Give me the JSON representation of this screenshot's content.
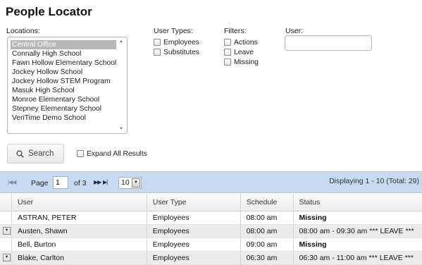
{
  "page": {
    "title": "People Locator"
  },
  "locations": {
    "label": "Locations:",
    "items": [
      "Central Office",
      "Connally High School",
      "Fawn Hollow Elementary School",
      "Jockey Hollow School",
      "Jockey Hollow STEM Program",
      "Masuk High School",
      "Monroe Elementary School",
      "Stepney Elementary School",
      "VeriTime Demo School"
    ],
    "selected_index": 0
  },
  "user_types": {
    "label": "User Types:",
    "options": [
      "Employees",
      "Substitutes"
    ]
  },
  "filters": {
    "label": "Filters:",
    "options": [
      "Actions",
      "Leave",
      "Missing"
    ]
  },
  "user": {
    "label": "User:",
    "value": ""
  },
  "search": {
    "label": "Search",
    "expand_label": "Expand All Results"
  },
  "pager": {
    "page_label": "Page",
    "page_value": "1",
    "of_label": "of 3",
    "page_size": "10",
    "displaying": "Displaying 1 - 10  (Total: 29)"
  },
  "table": {
    "columns": [
      "User",
      "User Type",
      "Schedule",
      "Status"
    ],
    "rows": [
      {
        "user": "ASTRAN, PETER",
        "type": "Employees",
        "schedule": "08:00 am",
        "status": "Missing"
      },
      {
        "user": "Austen, Shawn",
        "type": "Employees",
        "schedule": "08:00 am",
        "status": "08:00 am - 09:30 am *** LEAVE ***"
      },
      {
        "user": "Bell, Burton",
        "type": "Employees",
        "schedule": "09:00 am",
        "status": "Missing"
      },
      {
        "user": "Blake, Carlton",
        "type": "Employees",
        "schedule": "06:30 am",
        "status": "06:30 am - 11:00 am *** LEAVE ***"
      }
    ]
  },
  "colors": {
    "toolbar": "#c7daf1",
    "missing": "#e00000",
    "selected_location": "#b7b7b7"
  }
}
